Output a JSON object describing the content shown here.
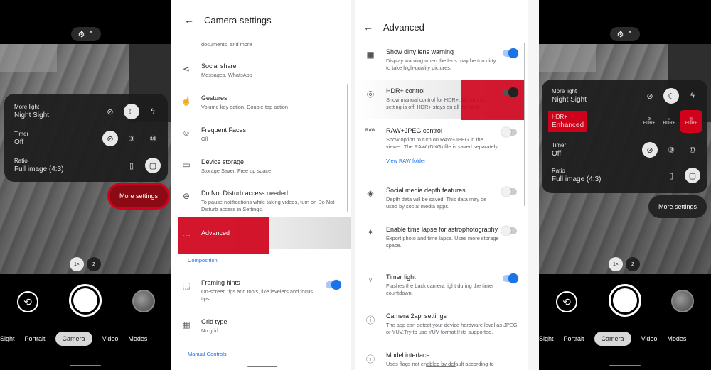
{
  "left_camera": {
    "qs": {
      "more_light_title": "More light",
      "more_light_value": "Night Sight",
      "timer_title": "Timer",
      "timer_value": "Off",
      "ratio_title": "Ratio",
      "ratio_value": "Full image (4:3)"
    },
    "more_settings": "More settings",
    "zoom": [
      "1×",
      "2"
    ],
    "modes": [
      "ht Sight",
      "Portrait",
      "Camera",
      "Video",
      "Modes"
    ]
  },
  "right_camera": {
    "qs": {
      "more_light_title": "More light",
      "more_light_value": "Night Sight",
      "hdr_title": "HDR+",
      "hdr_value": "Enhanced",
      "hdr_icon_labels": [
        "HDR+",
        "HDR+",
        "HDR+"
      ],
      "timer_title": "Timer",
      "timer_value": "Off",
      "ratio_title": "Ratio",
      "ratio_value": "Full image (4:3)"
    },
    "more_settings": "More settings",
    "zoom": [
      "1×",
      "2"
    ],
    "modes": [
      "ht Sight",
      "Portrait",
      "Camera",
      "Video",
      "Modes"
    ]
  },
  "camera_settings": {
    "title": "Camera settings",
    "partial_top": "documents, and more",
    "items": [
      {
        "title": "Social share",
        "sub": "Messages, WhatsApp",
        "icon": "share-icon"
      },
      {
        "title": "Gestures",
        "sub": "Volume key action, Double-tap action",
        "icon": "gesture-icon"
      },
      {
        "title": "Frequent Faces",
        "sub": "Off",
        "icon": "face-icon"
      },
      {
        "title": "Device storage",
        "sub": "Storage Saver, Free up space",
        "icon": "storage-icon"
      },
      {
        "title": "Do Not Disturb access needed",
        "sub": "To pause notifications while taking videos, turn on Do Not Disturb access in Settings.",
        "icon": "dnd-icon"
      },
      {
        "title": "Advanced",
        "sub": "",
        "icon": "more-icon"
      }
    ],
    "section_composition": "Composition",
    "composition_items": [
      {
        "title": "Framing hints",
        "sub": "On-screen tips and tools, like levelers and focus tips",
        "icon": "framing-icon"
      },
      {
        "title": "Grid type",
        "sub": "No grid",
        "icon": "grid-icon"
      }
    ],
    "section_manual": "Manual Controls"
  },
  "advanced": {
    "title": "Advanced",
    "items": [
      {
        "title": "Show dirty lens warning",
        "sub": "Display warning when the lens may be too dirty to take high-quality pictures."
      },
      {
        "title": "HDR+ control",
        "sub": "Show manual control for HDR+. When this setting is off, HDR+ stays on all the time."
      },
      {
        "title": "RAW+JPEG control",
        "sub": "Show option to turn on RAW+JPEG in the viewer. The RAW (DNG) file is saved separately.",
        "link": "View RAW folder"
      },
      {
        "title": "Social media depth features",
        "sub": "Depth data will be saved. This data may be used by social media apps."
      },
      {
        "title": "Enable time lapse for astrophotography.",
        "sub": "Export photo and time lapse. Uses more storage space."
      },
      {
        "title": "Timer light",
        "sub": "Flashes the back camera light during the timer countdown."
      },
      {
        "title": "Camera 2api settings",
        "sub": "The app can detect your device hardware level as JPEG or YUV.Try to use YUV format,If its supported."
      },
      {
        "title": "Model interface",
        "sub": "Uses flags not enabled by default according to"
      }
    ],
    "raw_icon_label": "RAW"
  }
}
